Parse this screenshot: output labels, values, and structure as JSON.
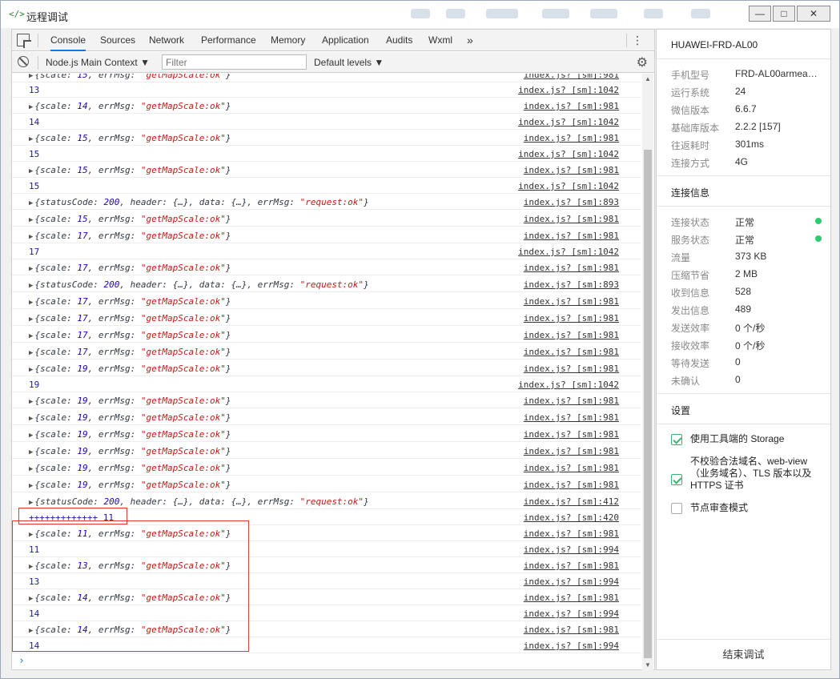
{
  "window": {
    "title": "远程调试",
    "minimize": "—",
    "maximize": "□",
    "close": "✕"
  },
  "tabs": [
    "Console",
    "Sources",
    "Network",
    "Performance",
    "Memory",
    "Application",
    "Audits",
    "Wxml"
  ],
  "tabs_more": "»",
  "menu_icon": "⋮",
  "filterbar": {
    "context": "Node.js Main Context",
    "filter_placeholder": "Filter",
    "levels": "Default levels"
  },
  "icons": {
    "inspect": "inspect-icon",
    "clear": "clear-console-icon",
    "settings": "gear-icon"
  },
  "console_rows": [
    {
      "kind": "obj",
      "scale": "15",
      "src": "index.js? [sm]:981",
      "clipped": true
    },
    {
      "kind": "num",
      "text": "13",
      "src": "index.js? [sm]:1042"
    },
    {
      "kind": "obj",
      "scale": "14",
      "src": "index.js? [sm]:981"
    },
    {
      "kind": "num",
      "text": "14",
      "src": "index.js? [sm]:1042"
    },
    {
      "kind": "obj",
      "scale": "15",
      "src": "index.js? [sm]:981"
    },
    {
      "kind": "num",
      "text": "15",
      "src": "index.js? [sm]:1042"
    },
    {
      "kind": "obj",
      "scale": "15",
      "src": "index.js? [sm]:981"
    },
    {
      "kind": "num",
      "text": "15",
      "src": "index.js? [sm]:1042"
    },
    {
      "kind": "req",
      "src": "index.js? [sm]:893"
    },
    {
      "kind": "obj",
      "scale": "15",
      "src": "index.js? [sm]:981"
    },
    {
      "kind": "obj",
      "scale": "17",
      "src": "index.js? [sm]:981"
    },
    {
      "kind": "num",
      "text": "17",
      "src": "index.js? [sm]:1042"
    },
    {
      "kind": "obj",
      "scale": "17",
      "src": "index.js? [sm]:981"
    },
    {
      "kind": "req",
      "src": "index.js? [sm]:893"
    },
    {
      "kind": "obj",
      "scale": "17",
      "src": "index.js? [sm]:981"
    },
    {
      "kind": "obj",
      "scale": "17",
      "src": "index.js? [sm]:981"
    },
    {
      "kind": "obj",
      "scale": "17",
      "src": "index.js? [sm]:981"
    },
    {
      "kind": "obj",
      "scale": "17",
      "src": "index.js? [sm]:981"
    },
    {
      "kind": "obj",
      "scale": "19",
      "src": "index.js? [sm]:981"
    },
    {
      "kind": "num",
      "text": "19",
      "src": "index.js? [sm]:1042"
    },
    {
      "kind": "obj",
      "scale": "19",
      "src": "index.js? [sm]:981"
    },
    {
      "kind": "obj",
      "scale": "19",
      "src": "index.js? [sm]:981"
    },
    {
      "kind": "obj",
      "scale": "19",
      "src": "index.js? [sm]:981"
    },
    {
      "kind": "obj",
      "scale": "19",
      "src": "index.js? [sm]:981"
    },
    {
      "kind": "obj",
      "scale": "19",
      "src": "index.js? [sm]:981"
    },
    {
      "kind": "obj",
      "scale": "19",
      "src": "index.js? [sm]:981"
    },
    {
      "kind": "req",
      "src": "index.js? [sm]:412"
    },
    {
      "kind": "num",
      "text": "+++++++++++++ 11",
      "src": "index.js? [sm]:420"
    },
    {
      "kind": "obj",
      "scale": "11",
      "src": "index.js? [sm]:981"
    },
    {
      "kind": "num",
      "text": "11",
      "src": "index.js? [sm]:994"
    },
    {
      "kind": "obj",
      "scale": "13",
      "src": "index.js? [sm]:981"
    },
    {
      "kind": "num",
      "text": "13",
      "src": "index.js? [sm]:994"
    },
    {
      "kind": "obj",
      "scale": "14",
      "src": "index.js? [sm]:981"
    },
    {
      "kind": "num",
      "text": "14",
      "src": "index.js? [sm]:994"
    },
    {
      "kind": "obj",
      "scale": "14",
      "src": "index.js? [sm]:981"
    },
    {
      "kind": "num",
      "text": "14",
      "src": "index.js? [sm]:994"
    }
  ],
  "console_text": {
    "scale_key": "scale",
    "errmsg_key": "errMsg",
    "errmsg_val": "\"getMapScale:ok\"",
    "status_key": "statusCode",
    "status_val": "200",
    "header_key": "header",
    "data_key": "data",
    "ellipsis_obj": "{…}",
    "req_val": "\"request:ok\"",
    "prompt": "›"
  },
  "panel": {
    "device": "HUAWEI-FRD-AL00",
    "info": [
      {
        "k": "手机型号",
        "v": "FRD-AL00armea…"
      },
      {
        "k": "运行系统",
        "v": "24"
      },
      {
        "k": "微信版本",
        "v": "6.6.7"
      },
      {
        "k": "基础库版本",
        "v": "2.2.2 [157]"
      },
      {
        "k": "往返耗时",
        "v": "301ms"
      },
      {
        "k": "连接方式",
        "v": "4G"
      }
    ],
    "conn_title": "连接信息",
    "conn": [
      {
        "k": "连接状态",
        "v": "正常",
        "dot": true
      },
      {
        "k": "服务状态",
        "v": "正常",
        "dot": true
      },
      {
        "k": "流量",
        "v": "373 KB"
      },
      {
        "k": "压缩节省",
        "v": "2 MB"
      },
      {
        "k": "收到信息",
        "v": "528"
      },
      {
        "k": "发出信息",
        "v": "489"
      },
      {
        "k": "发送效率",
        "v": "0 个/秒"
      },
      {
        "k": "接收效率",
        "v": "0 个/秒"
      },
      {
        "k": "等待发送",
        "v": "0"
      },
      {
        "k": "未确认",
        "v": "0"
      }
    ],
    "settings_title": "设置",
    "settings": [
      {
        "label": "使用工具端的 Storage",
        "checked": true
      },
      {
        "label": "不校验合法域名、web-view（业务域名）、TLS 版本以及 HTTPS 证书",
        "checked": true
      },
      {
        "label": "节点审查模式",
        "checked": false
      }
    ],
    "end_button": "结束调试",
    "status_color": "#2ecc71"
  }
}
